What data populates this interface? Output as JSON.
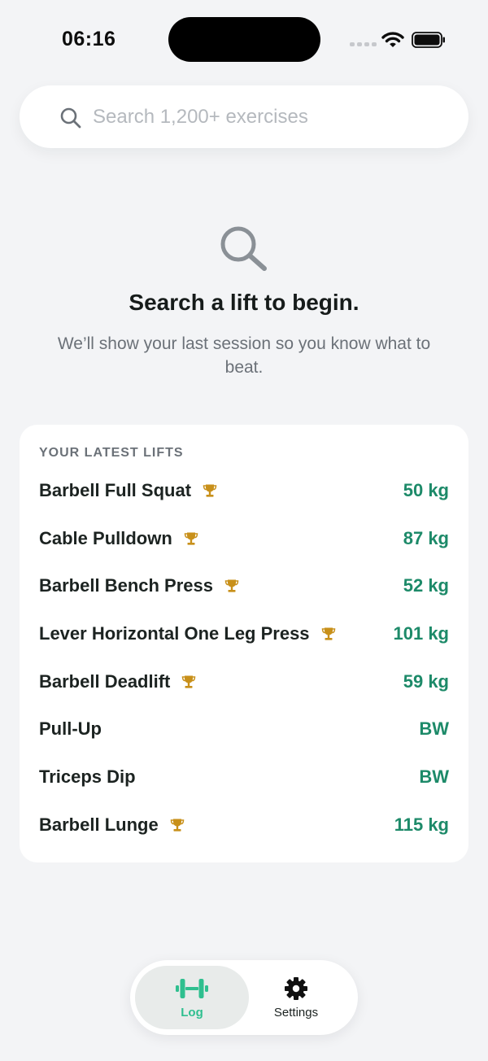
{
  "status_bar": {
    "time": "06:16",
    "icons": [
      "cellular-signal-icon",
      "wifi-icon",
      "battery-icon"
    ]
  },
  "search": {
    "placeholder": "Search 1,200+ exercises",
    "value": "",
    "icon": "search-icon"
  },
  "empty_state": {
    "icon": "search-icon",
    "title": "Search a lift to begin.",
    "subtitle": "We’ll show your last session so you know what to beat."
  },
  "latest_lifts": {
    "header": "YOUR LATEST LIFTS",
    "items": [
      {
        "name": "Barbell Full Squat",
        "value": "50 kg",
        "trophy": true
      },
      {
        "name": "Cable Pulldown",
        "value": "87 kg",
        "trophy": true
      },
      {
        "name": "Barbell Bench Press",
        "value": "52 kg",
        "trophy": true
      },
      {
        "name": "Lever Horizontal One Leg Press",
        "value": "101 kg",
        "trophy": true
      },
      {
        "name": "Barbell Deadlift",
        "value": "59 kg",
        "trophy": true
      },
      {
        "name": "Pull-Up",
        "value": "BW",
        "trophy": false
      },
      {
        "name": "Triceps Dip",
        "value": "BW",
        "trophy": false
      },
      {
        "name": "Barbell Lunge",
        "value": "115 kg",
        "trophy": true
      }
    ]
  },
  "tab_bar": {
    "tabs": [
      {
        "label": "Log",
        "icon": "dumbbell-icon",
        "active": true
      },
      {
        "label": "Settings",
        "icon": "gear-icon",
        "active": false
      }
    ]
  },
  "colors": {
    "background": "#f3f4f6",
    "accent_green": "#1d8a69",
    "tab_active_green": "#2fbf8f",
    "trophy_gold": "#c8901a"
  }
}
